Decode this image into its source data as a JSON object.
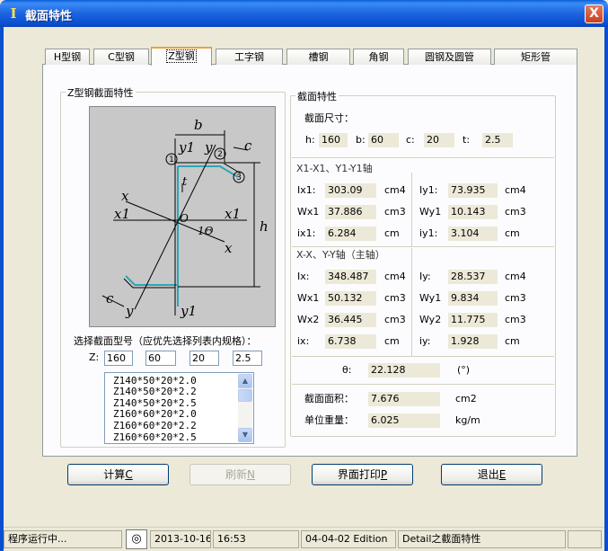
{
  "window": {
    "title": "截面特性",
    "icon": "I",
    "close_label": "X"
  },
  "tabs": [
    {
      "label": "H型钢"
    },
    {
      "label": "C型钢"
    },
    {
      "label": "Z型钢"
    },
    {
      "label": "工字钢"
    },
    {
      "label": "槽钢"
    },
    {
      "label": "角钢"
    },
    {
      "label": "圆钢及圆管"
    },
    {
      "label": "矩形管"
    }
  ],
  "active_tab_index": 2,
  "left_group": {
    "title": "Z型钢截面特性",
    "diagram_labels": {
      "b": "b",
      "y1_top": "y1",
      "y_top": "y",
      "c_top": "c",
      "circle1": "1",
      "circle2": "2",
      "circle3": "3",
      "t": "t",
      "x": "x",
      "x1_left": "x1",
      "x1_right": "x1",
      "o": "O",
      "theta": "1Θ",
      "x_right": "x",
      "h": "h",
      "c_bottom": "c",
      "y_bottom": "y",
      "y1_bottom": "y1"
    },
    "select_label": "选择截面型号（应优先选择列表内规格）：",
    "z_label": "Z:",
    "inputs": [
      "160",
      "60",
      "20",
      "2.5"
    ],
    "list_items": [
      "Z140*50*20*2.0",
      "Z140*50*20*2.2",
      "Z140*50*20*2.5",
      "Z160*60*20*2.0",
      "Z160*60*20*2.2",
      "Z160*60*20*2.5"
    ]
  },
  "right_group": {
    "title": "截面特性",
    "dims_label": "截面尺寸：",
    "dims": [
      {
        "label": "h:",
        "value": "160"
      },
      {
        "label": "b:",
        "value": "60"
      },
      {
        "label": "c:",
        "value": "20"
      },
      {
        "label": "t:",
        "value": "2.5"
      }
    ],
    "axis1_title": "X1-X1、Y1-Y1轴",
    "axis1_rows": [
      {
        "l": "Ix1:",
        "lv": "303.09",
        "lu": "cm4",
        "r": "Iy1:",
        "rv": "73.935",
        "ru": "cm4"
      },
      {
        "l": "Wx1",
        "lv": "37.886",
        "lu": "cm3",
        "r": "Wy1",
        "rv": "10.143",
        "ru": "cm3"
      },
      {
        "l": "ix1:",
        "lv": "6.284",
        "lu": "cm",
        "r": "iy1:",
        "rv": "3.104",
        "ru": "cm"
      }
    ],
    "axis2_title": "X-X、Y-Y轴（主轴）",
    "axis2_rows": [
      {
        "l": "Ix:",
        "lv": "348.487",
        "lu": "cm4",
        "r": "Iy:",
        "rv": "28.537",
        "ru": "cm4"
      },
      {
        "l": "Wx1",
        "lv": "50.132",
        "lu": "cm3",
        "r": "Wy1",
        "rv": "9.834",
        "ru": "cm3"
      },
      {
        "l": "Wx2",
        "lv": "36.445",
        "lu": "cm3",
        "r": "Wy2",
        "rv": "11.775",
        "ru": "cm3"
      },
      {
        "l": "ix:",
        "lv": "6.738",
        "lu": "cm",
        "r": "iy:",
        "rv": "1.928",
        "ru": "cm"
      }
    ],
    "theta_label": "θ:",
    "theta_value": "22.128",
    "theta_unit": "(°)",
    "area_label": "截面面积：",
    "area_value": "7.676",
    "area_unit": "cm2",
    "weight_label": "单位重量：",
    "weight_value": "6.025",
    "weight_unit": "kg/m"
  },
  "buttons": {
    "calc": {
      "label": "计算",
      "key": "C"
    },
    "refresh": {
      "label": "刷新",
      "key": "N"
    },
    "print": {
      "label": "界面打印",
      "key": "P"
    },
    "exit": {
      "label": "退出",
      "key": "E"
    }
  },
  "statusbar": {
    "running": "程序运行中...",
    "date": "2013-10-16",
    "time": "16:53",
    "edition": "04-04-02 Edition",
    "detail": "Detail之截面特性"
  }
}
